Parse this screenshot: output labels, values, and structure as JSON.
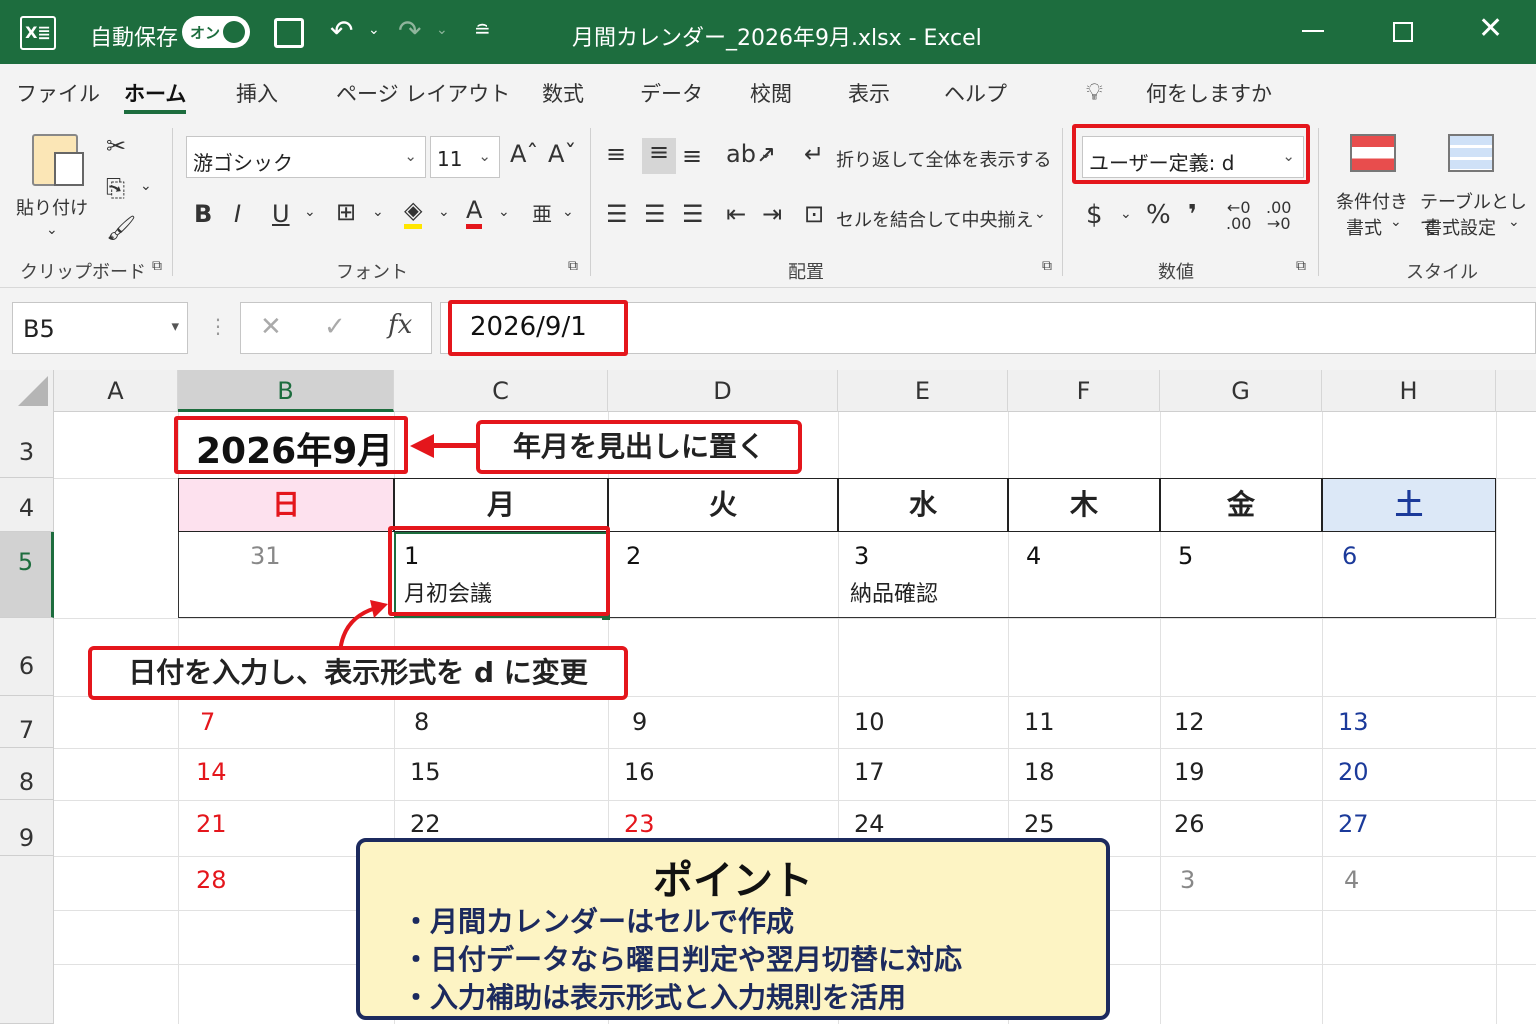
{
  "titlebar": {
    "app_icon": "excel-icon",
    "autosave_label": "自動保存",
    "autosave_state": "オン",
    "file_title": "月間カレンダー_2026年9月.xlsx - Excel"
  },
  "menu": {
    "tabs": [
      "ファイル",
      "ホーム",
      "挿入",
      "ページ レイアウト",
      "数式",
      "データ",
      "校閲",
      "表示",
      "ヘルプ"
    ],
    "active_tab": "ホーム",
    "tell_me": "何をしますか"
  },
  "ribbon": {
    "paste_label": "貼り付け",
    "font_name": "游ゴシック",
    "font_size": "11",
    "wrap_text": "折り返して全体を表示する",
    "merge_center": "セルを結合して中央揃え",
    "number_format": "ユーザー定義: d",
    "currency_symbol": "$",
    "percent_symbol": "%",
    "comma_symbol": "❜",
    "cond_format_1": "条件付き",
    "cond_format_2": "書式",
    "table_format_1": "テーブルとして",
    "table_format_2": "書式設定",
    "groups": [
      "クリップボード",
      "フォント",
      "配置",
      "数値",
      "スタイル"
    ]
  },
  "formula_bar": {
    "name_box": "B5",
    "fx": "fx",
    "value": "2026/9/1"
  },
  "grid": {
    "columns": [
      "A",
      "B",
      "C",
      "D",
      "E",
      "F",
      "G",
      "H"
    ],
    "rows": [
      "3",
      "4",
      "5",
      "6",
      "7",
      "8",
      "9"
    ],
    "heading": "2026年9月",
    "weekdays": [
      "日",
      "月",
      "火",
      "水",
      "木",
      "金",
      "土"
    ],
    "week1": [
      "31",
      "1",
      "2",
      "3",
      "4",
      "5",
      "6"
    ],
    "week2": [
      "7",
      "8",
      "9",
      "10",
      "11",
      "12",
      "13"
    ],
    "week3": [
      "14",
      "15",
      "16",
      "17",
      "18",
      "19",
      "20"
    ],
    "week4": [
      "21",
      "22",
      "23",
      "24",
      "25",
      "26",
      "27"
    ],
    "week5": [
      "28",
      "3",
      "4"
    ],
    "memo_mon": "月初会議",
    "memo_wed": "納品確認"
  },
  "annotations": {
    "heading_note": "年月を見出しに置く",
    "date_note": "日付を入力し、表示形式を d に変更"
  },
  "point_box": {
    "title": "ポイント",
    "items": [
      "・月間カレンダーはセルで作成",
      "・日付データなら曜日判定や翌月切替に対応",
      "・入力補助は表示形式と入力規則を活用"
    ]
  },
  "colors": {
    "title_green": "#1d6d3e",
    "highlight_red": "#e4161c",
    "sunday_red": "#e4161c",
    "saturday_blue": "#1b3a9a",
    "sunday_header_bg": "#fde1ee",
    "saturday_header_bg": "#dce8f7",
    "point_bg": "#fdf4c4"
  }
}
